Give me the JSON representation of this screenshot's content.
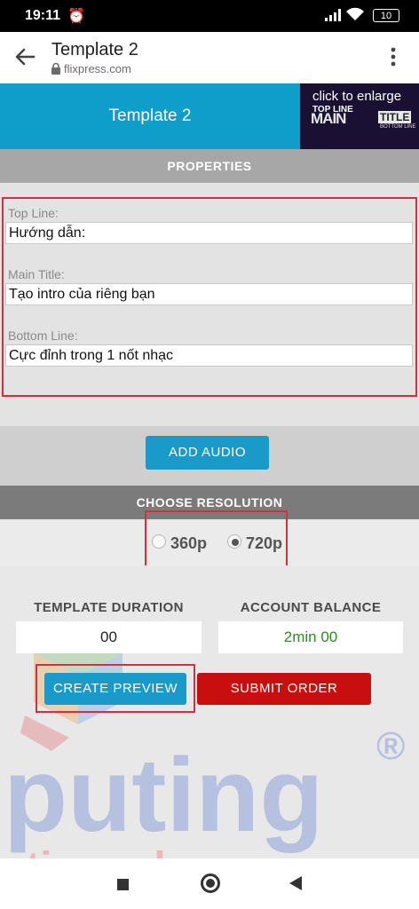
{
  "status": {
    "time": "19:11",
    "battery": "10"
  },
  "browser": {
    "title": "Template 2",
    "url": "flixpress.com"
  },
  "header": {
    "title": "Template 2",
    "thumb_caption": "click to enlarge",
    "thumb_top": "TOP LINE",
    "thumb_main": "MAIN",
    "thumb_title": "TITLE",
    "thumb_bottom": "BOTTOM LINE"
  },
  "properties": {
    "heading": "PROPERTIES",
    "top_line_label": "Top Line:",
    "top_line_value": "Hướng dẫn:",
    "main_title_label": "Main Title:",
    "main_title_value": "Tạo intro của riêng bạn",
    "bottom_line_label": "Bottom Line:",
    "bottom_line_value": "Cực đỉnh trong 1 nốt nhạc"
  },
  "audio": {
    "button": "ADD AUDIO"
  },
  "resolution": {
    "heading": "CHOOSE RESOLUTION",
    "options": [
      "360p",
      "720p"
    ],
    "selected": "720p"
  },
  "summary": {
    "duration_label": "TEMPLATE DURATION",
    "duration_value": "00",
    "balance_label": "ACCOUNT BALANCE",
    "balance_value": "2min 00",
    "balance_color": "#2e8b1f"
  },
  "actions": {
    "preview": "CREATE PREVIEW",
    "submit": "SUBMIT ORDER"
  },
  "watermark": {
    "main": "puting",
    "url": "uting.edu.vn",
    "reg": "®"
  },
  "colors": {
    "accent": "#199ac8",
    "header": "#0f9dc9",
    "danger": "#c80e0e",
    "highlight": "#d32f3f"
  }
}
